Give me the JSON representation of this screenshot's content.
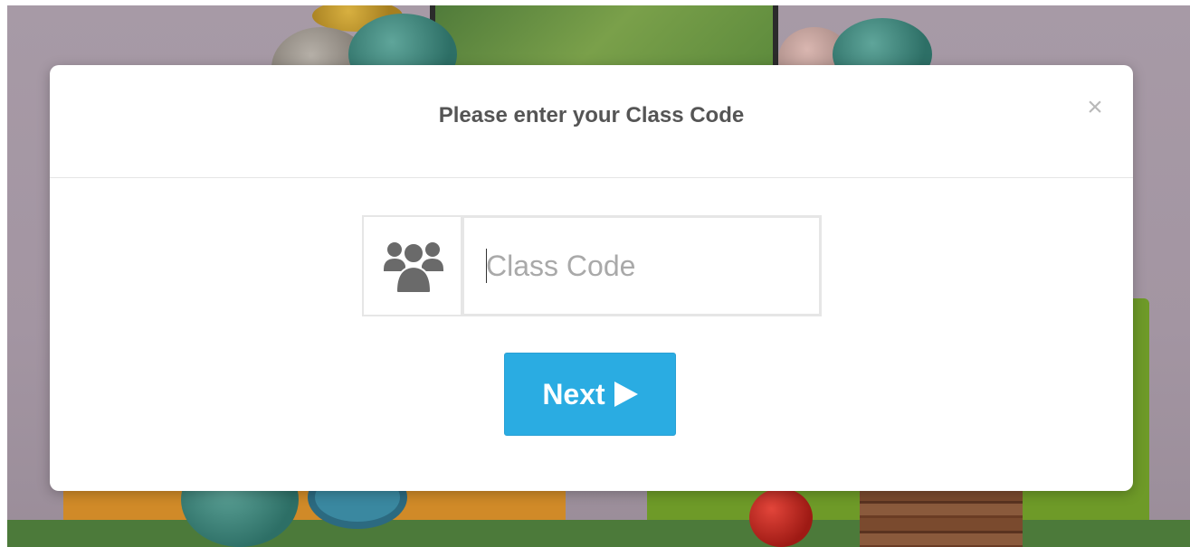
{
  "modal": {
    "title": "Please enter your Class Code",
    "close_symbol": "×",
    "close_icon": "close-icon",
    "addon_icon": "users-group-icon",
    "class_code_input": {
      "value": "",
      "placeholder": "Class Code"
    },
    "next_button": {
      "label": "Next",
      "icon": "play-triangle-icon"
    }
  },
  "colors": {
    "accent": "#2aace2",
    "title_text": "#555555",
    "icon_gray": "#6a6a6a",
    "border": "#e6e6e6"
  }
}
